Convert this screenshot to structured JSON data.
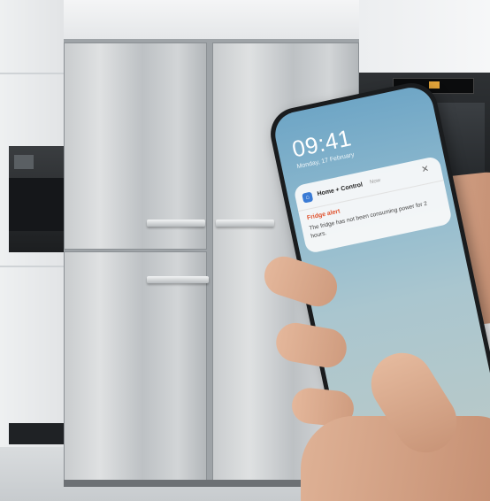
{
  "phone": {
    "time": "09:41",
    "date": "Monday, 17 February"
  },
  "notification": {
    "app_name": "Home + Control",
    "timestamp": "Now",
    "title": "Fridge alert",
    "body": "The fridge has not been consuming power for 2 hours.",
    "accent_color": "#e0532f",
    "app_icon": "home-control-icon",
    "close_icon": "close-icon"
  }
}
